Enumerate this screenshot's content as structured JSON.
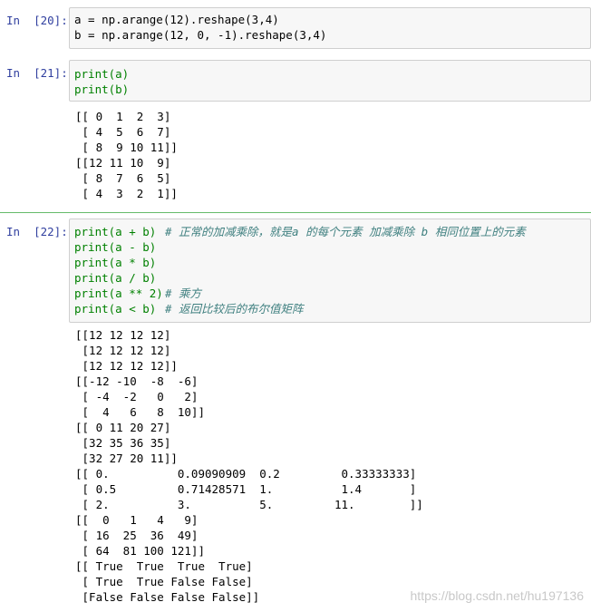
{
  "cells": [
    {
      "prompt": "In  [20]:",
      "code": [
        "a = np.arange(12).reshape(3,4)",
        "b = np.arange(12, 0, -1).reshape(3,4)"
      ],
      "output": []
    },
    {
      "prompt": "In  [21]:",
      "code": [
        "print(a)",
        "print(b)"
      ],
      "output": [
        "[[ 0  1  2  3]",
        " [ 4  5  6  7]",
        " [ 8  9 10 11]]",
        "[[12 11 10  9]",
        " [ 8  7  6  5]",
        " [ 4  3  2  1]]"
      ]
    },
    {
      "prompt": "In  [22]:",
      "code": [
        "print(a + b)",
        "print(a - b)",
        "print(a * b)",
        "print(a / b)",
        "print(a ** 2)",
        "print(a < b)"
      ],
      "comments": [
        "# 正常的加减乘除，就是a 的每个元素 加减乘除 b 相同位置上的元素",
        "",
        "",
        "",
        "# 乘方",
        "# 返回比较后的布尔值矩阵"
      ],
      "output": [
        "[[12 12 12 12]",
        " [12 12 12 12]",
        " [12 12 12 12]]",
        "[[-12 -10  -8  -6]",
        " [ -4  -2   0   2]",
        " [  4   6   8  10]]",
        "[[ 0 11 20 27]",
        " [32 35 36 35]",
        " [32 27 20 11]]",
        "[[ 0.          0.09090909  0.2         0.33333333]",
        " [ 0.5         0.71428571  1.          1.4       ]",
        " [ 2.          3.          5.         11.        ]]",
        "[[  0   1   4   9]",
        " [ 16  25  36  49]",
        " [ 64  81 100 121]]",
        "[[ True  True  True  True]",
        " [ True  True False False]",
        " [False False False False]]"
      ]
    }
  ],
  "watermark": "https://blog.csdn.net/hu197136"
}
